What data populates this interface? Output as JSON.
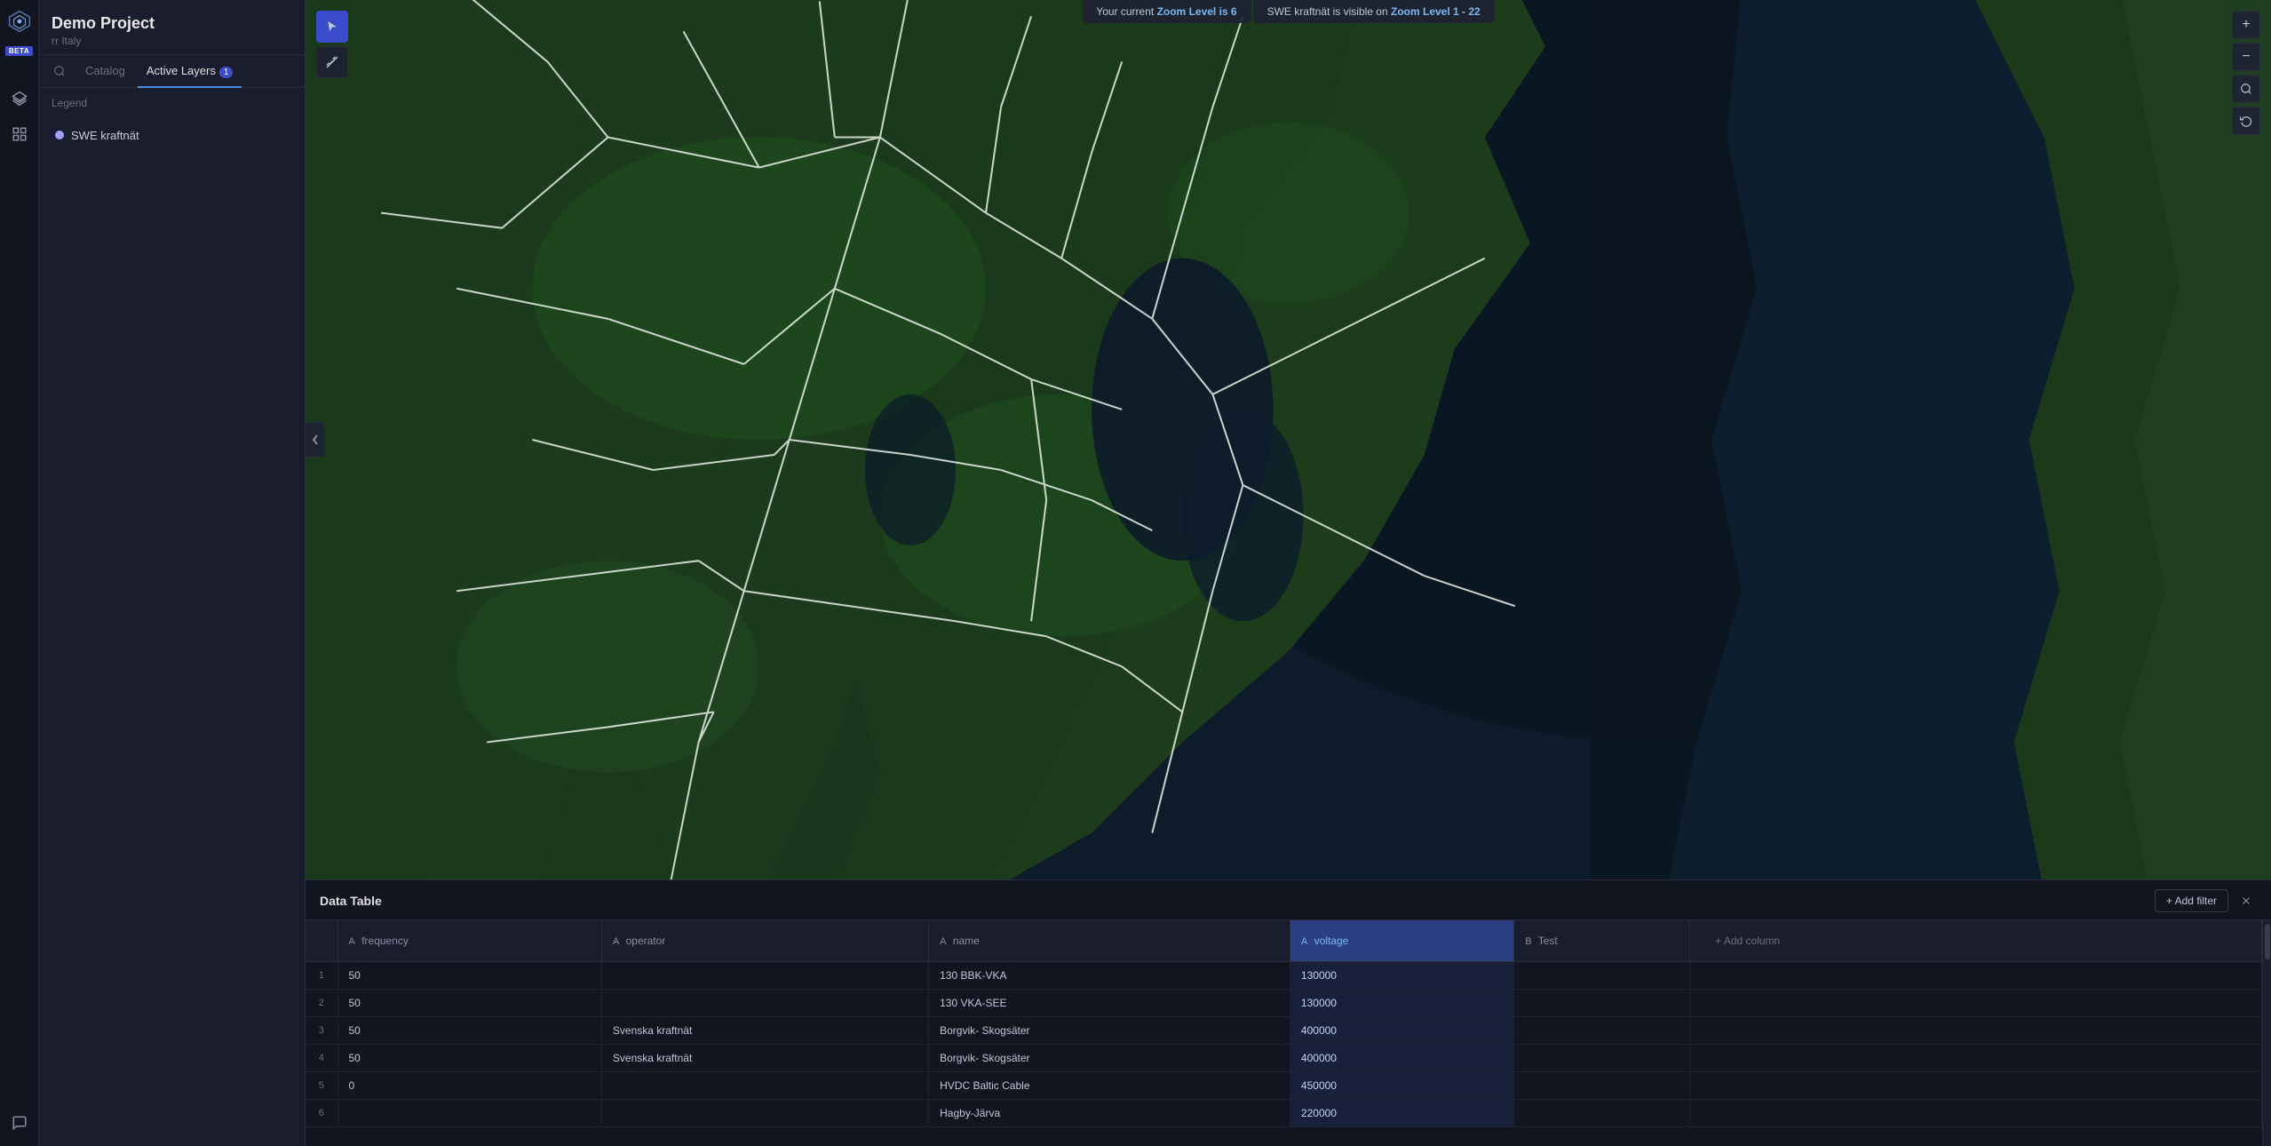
{
  "app": {
    "beta_label": "BETA"
  },
  "project": {
    "title": "Demo Project",
    "subtitle": "rr Italy"
  },
  "sidebar_icons": {
    "search": "🔍",
    "layers": "⊞",
    "chart": "📊",
    "comment": "💬"
  },
  "tabs": {
    "search_icon": "🔍",
    "catalog_label": "Catalog",
    "active_layers_label": "Active Layers",
    "active_layers_count": "1"
  },
  "legend": {
    "title": "Legend"
  },
  "layers": [
    {
      "name": "SWE kraftnät",
      "color": "#a0a0ff"
    }
  ],
  "zoom_bar": {
    "msg1_prefix": "Your current ",
    "msg1_highlight": "Zoom Level is 6",
    "msg2_prefix": "SWE kraftnät is visible on ",
    "msg2_highlight": "Zoom Level 1 - 22"
  },
  "map_toolbar": {
    "cursor_tool": "cursor",
    "measure_tool": "measure"
  },
  "map_controls": {
    "zoom_in": "+",
    "zoom_out": "−",
    "search": "🔍",
    "history": "⟳"
  },
  "data_table": {
    "title": "Data Table",
    "add_filter_label": "+ Add filter",
    "add_column_label": "+ Add column",
    "columns": [
      {
        "id": "row_num",
        "label": "",
        "type": ""
      },
      {
        "id": "frequency",
        "label": "frequency",
        "type": "A",
        "highlighted": false
      },
      {
        "id": "operator",
        "label": "operator",
        "type": "A",
        "highlighted": false
      },
      {
        "id": "name",
        "label": "name",
        "type": "A",
        "highlighted": false
      },
      {
        "id": "voltage",
        "label": "voltage",
        "type": "A",
        "highlighted": true
      },
      {
        "id": "test",
        "label": "Test",
        "type": "B",
        "highlighted": false
      }
    ],
    "rows": [
      {
        "row_num": "1",
        "frequency": "50",
        "operator": "",
        "name": "130 BBK-VKA",
        "voltage": "130000",
        "test": ""
      },
      {
        "row_num": "2",
        "frequency": "50",
        "operator": "",
        "name": "130 VKA-SEE",
        "voltage": "130000",
        "test": ""
      },
      {
        "row_num": "3",
        "frequency": "50",
        "operator": "Svenska kraftnät",
        "name": "Borgvik- Skogsäter",
        "voltage": "400000",
        "test": ""
      },
      {
        "row_num": "4",
        "frequency": "50",
        "operator": "Svenska kraftnät",
        "name": "Borgvik- Skogsäter",
        "voltage": "400000",
        "test": ""
      },
      {
        "row_num": "5",
        "frequency": "0",
        "operator": "",
        "name": "HVDC Baltic Cable",
        "voltage": "450000",
        "test": ""
      },
      {
        "row_num": "6",
        "frequency": "",
        "operator": "",
        "name": "Hagby-Järva",
        "voltage": "220000",
        "test": ""
      }
    ]
  }
}
